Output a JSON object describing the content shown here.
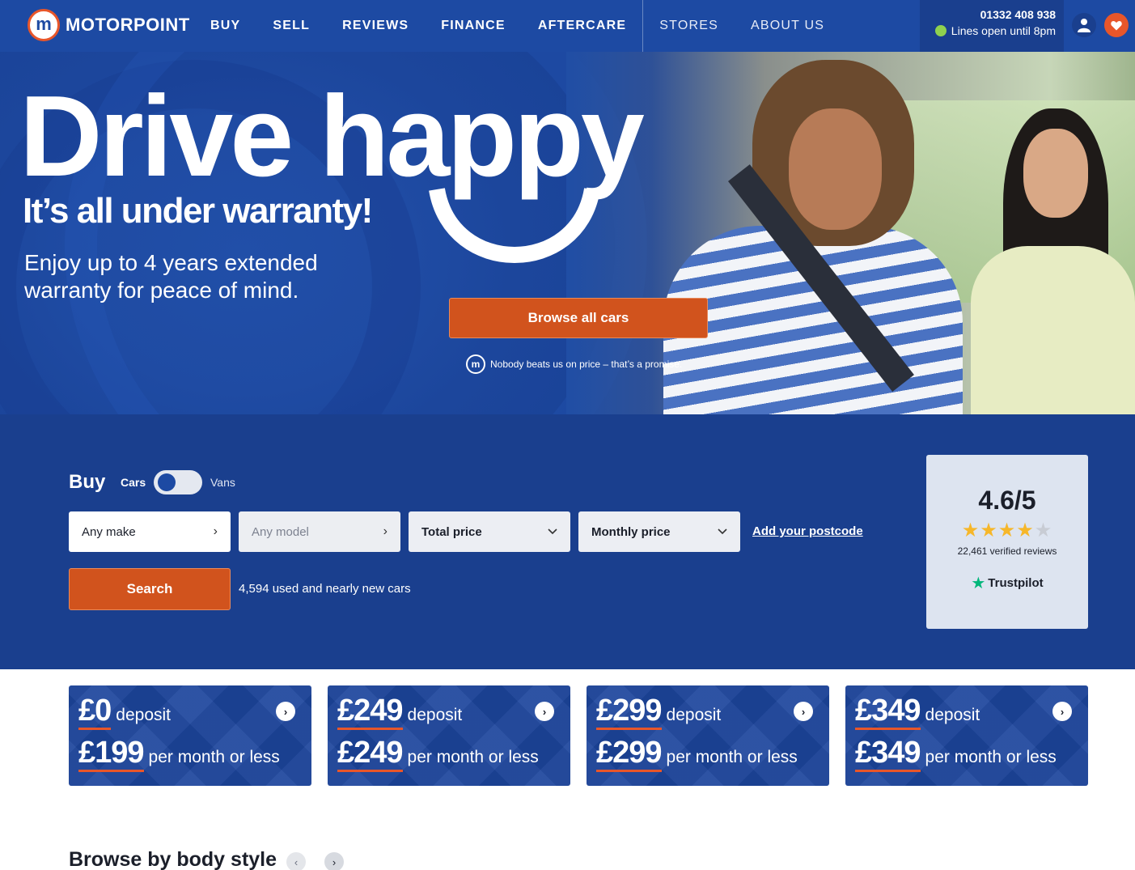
{
  "brand": {
    "name": "MOTORPOINT",
    "logo_letter": "m"
  },
  "nav": {
    "links": [
      "BUY",
      "SELL",
      "REVIEWS",
      "FINANCE",
      "AFTERCARE",
      "STORES",
      "ABOUT US"
    ],
    "phone": "01332 408 938",
    "lines_status": "Lines open until 8pm"
  },
  "hero": {
    "title": "Drive happy",
    "subtitle": "It’s all under warranty!",
    "body": "Enjoy up to 4 years extended warranty for peace of mind.",
    "cta": "Browse all cars",
    "promise": "Nobody beats us on price – that’s a promise."
  },
  "search": {
    "heading": "Buy",
    "toggle_left": "Cars",
    "toggle_right": "Vans",
    "make": "Any make",
    "model": "Any model",
    "total_price": "Total price",
    "monthly_price": "Monthly price",
    "postcode_link": "Add your postcode",
    "search_button": "Search",
    "count": "4,594 used and nearly new cars"
  },
  "trustpilot": {
    "score": "4.6/5",
    "rating": 4.6,
    "reviews": "22,461 verified reviews",
    "brand": "Trustpilot"
  },
  "promos": [
    {
      "deposit": "£0",
      "deposit_label": "deposit",
      "monthly": "£199",
      "monthly_label": "per month or less"
    },
    {
      "deposit": "£249",
      "deposit_label": "deposit",
      "monthly": "£249",
      "monthly_label": "per month or less"
    },
    {
      "deposit": "£299",
      "deposit_label": "deposit",
      "monthly": "£299",
      "monthly_label": "per month or less"
    },
    {
      "deposit": "£349",
      "deposit_label": "deposit",
      "monthly": "£349",
      "monthly_label": "per month or less"
    }
  ],
  "browse": {
    "heading": "Browse by body style"
  },
  "colors": {
    "primary": "#1d4aa3",
    "panel": "#1a3f8e",
    "accent": "#d1531d",
    "star": "#f6b72a",
    "trustpilot_green": "#00b67a"
  }
}
